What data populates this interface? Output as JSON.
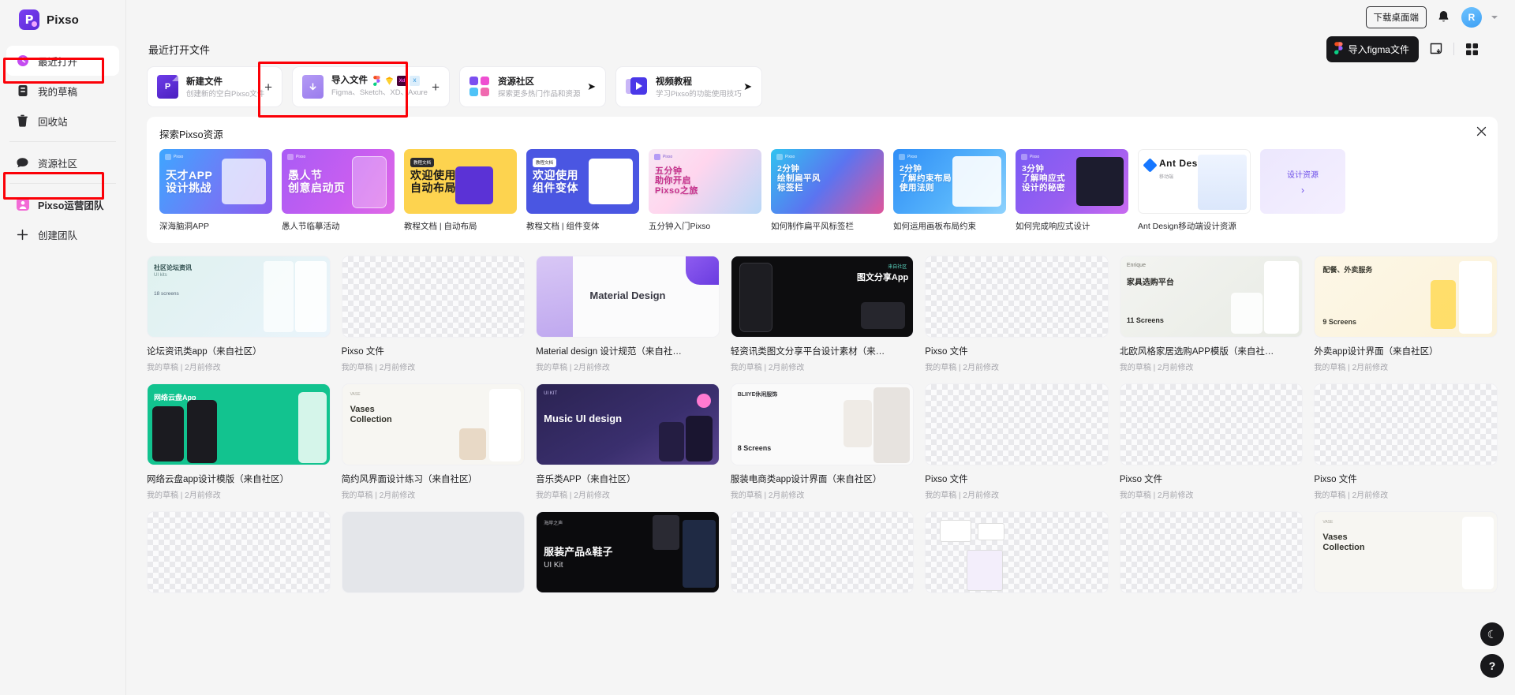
{
  "brand": {
    "name": "Pixso",
    "logo_letter": "P",
    "icon": "pixso-logo-icon"
  },
  "sidebar": {
    "items": [
      {
        "label": "最近打开",
        "icon": "clock-icon",
        "active": true
      },
      {
        "label": "我的草稿",
        "icon": "drafts-icon",
        "active": false
      },
      {
        "label": "回收站",
        "icon": "trash-icon",
        "active": false
      },
      {
        "label": "资源社区",
        "icon": "community-icon",
        "active": false
      },
      {
        "label": "Pixso运营团队",
        "icon": "team-avatar-icon",
        "active": false
      },
      {
        "label": "创建团队",
        "icon": "plus-icon",
        "active": false
      }
    ]
  },
  "topbar": {
    "download_label": "下载桌面端",
    "bell_icon": "bell-icon",
    "avatar_letter": "R",
    "caret_icon": "chevron-down-icon"
  },
  "header": {
    "recent_title": "最近打开文件",
    "import_figma_label": "导入figma文件",
    "figma_icon": "figma-icon",
    "sort_icon": "sort-icon",
    "view_grid_icon": "grid-view-icon"
  },
  "action_cards": [
    {
      "title": "新建文件",
      "subtitle": "创建新的空白Pixso文件",
      "icon": "new-file-icon",
      "action_icon": "plus-icon",
      "action_glyph": "+",
      "highlighted": true
    },
    {
      "title": "导入文件",
      "subtitle": "Figma、Sketch、XD、Axure",
      "icon": "import-file-icon",
      "action_icon": "plus-icon",
      "action_glyph": "+",
      "logos": [
        {
          "name": "figma-icon",
          "label": "F"
        },
        {
          "name": "sketch-icon",
          "label": "S"
        },
        {
          "name": "xd-icon",
          "label": "Xd"
        },
        {
          "name": "axure-icon",
          "label": "X"
        }
      ],
      "highlighted": false
    },
    {
      "title": "资源社区",
      "subtitle": "探索更多热门作品和资源",
      "icon": "community-grid-icon",
      "action_icon": "arrow-right-icon",
      "action_glyph": "➤",
      "highlighted": false
    },
    {
      "title": "视频教程",
      "subtitle": "学习Pixso的功能使用技巧",
      "icon": "video-tutorial-icon",
      "action_icon": "arrow-right-icon",
      "action_glyph": "➤",
      "highlighted": false
    }
  ],
  "explore": {
    "title": "探索Pixso资源",
    "close_icon": "close-icon",
    "cards": [
      {
        "caption": "深海脑洞APP",
        "headline": "天才APP\n设计挑战",
        "tag": "",
        "style": "blue"
      },
      {
        "caption": "愚人节临摹活动",
        "headline": "愚人节\n创意启动页",
        "tag": "",
        "style": "purple"
      },
      {
        "caption": "教程文档 | 自动布局",
        "headline": "欢迎使用\n自动布局",
        "tag": "教程文档",
        "style": "yellow"
      },
      {
        "caption": "教程文档 | 组件变体",
        "headline": "欢迎使用\n组件变体",
        "tag": "教程文档",
        "style": "indigo"
      },
      {
        "caption": "五分钟入门Pixso",
        "headline": "五分钟\n助你开启\nPixso之旅",
        "tag": "",
        "style": "pinkblue"
      },
      {
        "caption": "如何制作扁平风标签栏",
        "headline": "2分钟\n绘制扁平风\n标签栏",
        "tag": "",
        "style": "cyanpink"
      },
      {
        "caption": "如何运用画板布局约束",
        "headline": "2分钟\n了解约束布局\n使用法则",
        "tag": "",
        "style": "skyblue"
      },
      {
        "caption": "如何完成响应式设计",
        "headline": "3分钟\n了解响应式\n设计的秘密",
        "tag": "",
        "style": "violet"
      },
      {
        "caption": "Ant Design移动端设计资源",
        "headline": "Ant Design",
        "tag": "",
        "style": "white"
      },
      {
        "caption": "",
        "headline": "设计资源",
        "tag": "",
        "style": "lavender-more"
      }
    ]
  },
  "files": {
    "meta_template": "我的草稿 | 2月前修改",
    "rows": [
      [
        {
          "name": "论坛资讯类app（来自社区）",
          "meta": "我的草稿 | 2月前修改",
          "thumb": "preview-mockups"
        },
        {
          "name": "Pixso 文件",
          "meta": "我的草稿 | 2月前修改",
          "thumb": "empty-checker"
        },
        {
          "name": "Material design 设计规范（来自社…",
          "meta": "我的草稿 | 2月前修改",
          "thumb": "material-design"
        },
        {
          "name": "轻资讯类图文分享平台设计素材（来…",
          "meta": "我的草稿 | 2月前修改",
          "thumb": "dark-phone"
        },
        {
          "name": "Pixso 文件",
          "meta": "我的草稿 | 2月前修改",
          "thumb": "empty-checker"
        },
        {
          "name": "北欧风格家居选购APP模版（来自社…",
          "meta": "我的草稿 | 2月前修改",
          "thumb": "furniture"
        },
        {
          "name": "外卖app设计界面（来自社区）",
          "meta": "我的草稿 | 2月前修改",
          "thumb": "food-delivery"
        }
      ],
      [
        {
          "name": "网络云盘app设计模版（来自社区）",
          "meta": "我的草稿 | 2月前修改",
          "thumb": "cloud-green"
        },
        {
          "name": "简约风界面设计练习（来自社区）",
          "meta": "我的草稿 | 2月前修改",
          "thumb": "vases"
        },
        {
          "name": "音乐类APP（来自社区）",
          "meta": "我的草稿 | 2月前修改",
          "thumb": "music-ui"
        },
        {
          "name": "服装电商类app设计界面（来自社区）",
          "meta": "我的草稿 | 2月前修改",
          "thumb": "fashion"
        },
        {
          "name": "Pixso 文件",
          "meta": "我的草稿 | 2月前修改",
          "thumb": "empty-checker"
        },
        {
          "name": "Pixso 文件",
          "meta": "我的草稿 | 2月前修改",
          "thumb": "empty-checker"
        },
        {
          "name": "Pixso 文件",
          "meta": "我的草稿 | 2月前修改",
          "thumb": "empty-checker"
        }
      ],
      [
        {
          "name": "",
          "meta": "",
          "thumb": "empty-checker"
        },
        {
          "name": "",
          "meta": "",
          "thumb": "flat-gray"
        },
        {
          "name": "",
          "meta": "",
          "thumb": "fashion-uikit"
        },
        {
          "name": "",
          "meta": "",
          "thumb": "empty-checker"
        },
        {
          "name": "",
          "meta": "",
          "thumb": "wireframe"
        },
        {
          "name": "",
          "meta": "",
          "thumb": "empty-checker"
        },
        {
          "name": "",
          "meta": "",
          "thumb": "vases-2"
        }
      ]
    ],
    "thumb_texts": {
      "material_design": "Material Design",
      "music_ui": "Music UI design",
      "vases": "Vases\nCollection",
      "fashion_uikit_title": "服装产品&鞋子",
      "fashion_uikit_sub": "UI Kit",
      "forum_title": "社区论坛资讯",
      "forum_sub": "UI kits",
      "forum_screens": "18 screens",
      "cloud_title": "网络云盘App",
      "furniture_brand": "Enrique",
      "furniture_title": "家具选购平台",
      "furniture_screens": "11 Screens",
      "food_title": "配餐、外卖服务",
      "food_screens": "9 Screens",
      "fashion_brand": "BLIIYE休闲服饰",
      "fashion_screens": "8 Screens",
      "dark_phone_title": "图文分享App",
      "dark_phone_tag": "来自社区"
    }
  },
  "fabs": {
    "theme_icon": "moon-icon",
    "theme_glyph": "☾",
    "help_icon": "help-icon",
    "help_glyph": "?"
  },
  "colors": {
    "accent": "#6d3ce8",
    "highlight_box": "#fb0007",
    "dark_button": "#18181b",
    "page_bg": "#f5f5f5"
  }
}
